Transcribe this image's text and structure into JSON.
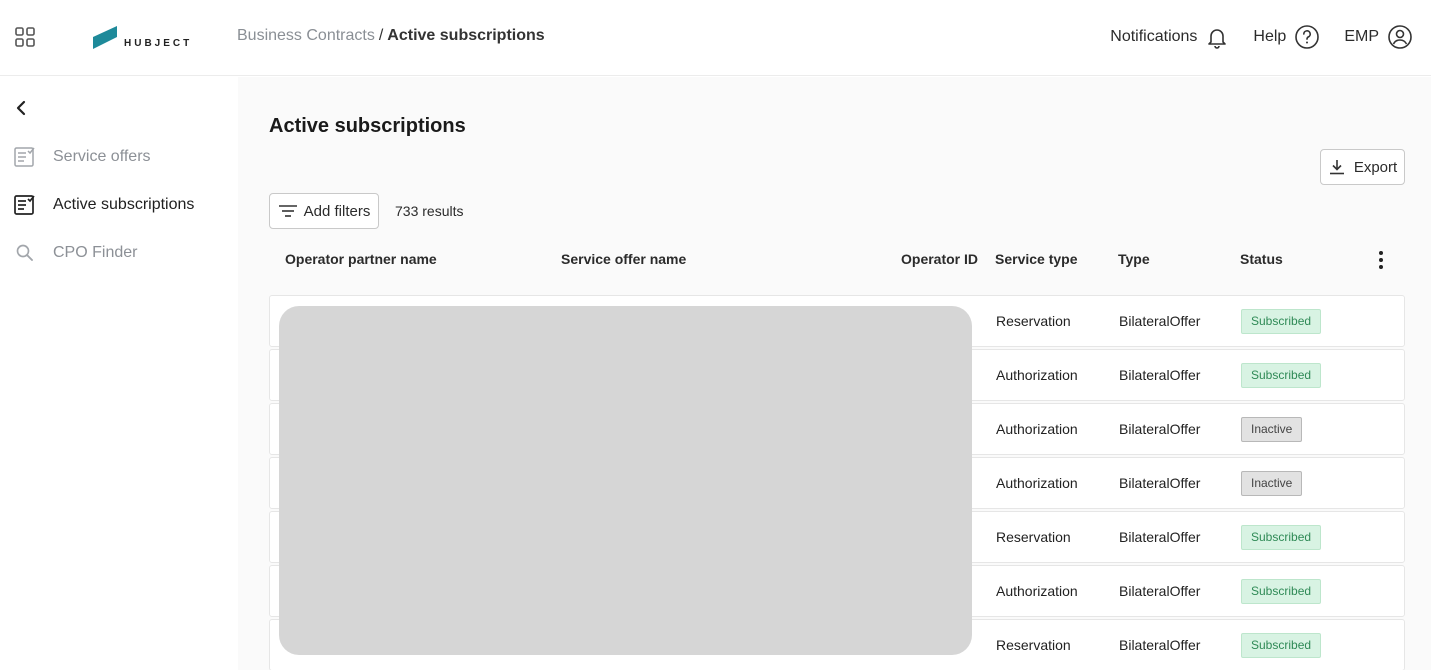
{
  "header": {
    "logo_text": "HUBJECT",
    "breadcrumb_root": "Business Contracts",
    "breadcrumb_sep": "/",
    "breadcrumb_current": "Active subscriptions",
    "notifications_label": "Notifications",
    "help_label": "Help",
    "user_label": "EMP"
  },
  "sidebar": {
    "items": [
      {
        "label": "Service offers",
        "icon": "list-check-icon",
        "active": false
      },
      {
        "label": "Active subscriptions",
        "icon": "list-check-icon",
        "active": true
      },
      {
        "label": "CPO Finder",
        "icon": "search-icon",
        "active": false
      }
    ]
  },
  "main": {
    "title": "Active subscriptions",
    "export_label": "Export",
    "filters_label": "Add filters",
    "results_text": "733 results",
    "columns": [
      "Operator partner name",
      "Service offer name",
      "Operator ID",
      "Service type",
      "Type",
      "Status"
    ],
    "rows": [
      {
        "service_type": "Reservation",
        "type": "BilateralOffer",
        "status": "Subscribed"
      },
      {
        "service_type": "Authorization",
        "type": "BilateralOffer",
        "status": "Subscribed"
      },
      {
        "service_type": "Authorization",
        "type": "BilateralOffer",
        "status": "Inactive"
      },
      {
        "service_type": "Authorization",
        "type": "BilateralOffer",
        "status": "Inactive"
      },
      {
        "service_type": "Reservation",
        "type": "BilateralOffer",
        "status": "Subscribed"
      },
      {
        "service_type": "Authorization",
        "type": "BilateralOffer",
        "status": "Subscribed"
      },
      {
        "service_type": "Reservation",
        "type": "BilateralOffer",
        "status": "Subscribed"
      }
    ]
  },
  "colors": {
    "brand": "#1e8a9a",
    "subscribed_bg": "#d8f3e3",
    "subscribed_text": "#2f8a56",
    "inactive_bg": "#e2e2e2",
    "redaction": "#d6d6d6"
  }
}
